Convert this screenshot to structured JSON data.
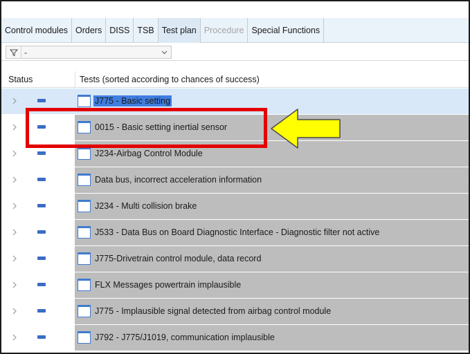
{
  "tabs": [
    {
      "label": "Control modules",
      "state": "normal"
    },
    {
      "label": "Orders",
      "state": "normal"
    },
    {
      "label": "DISS",
      "state": "normal"
    },
    {
      "label": "TSB",
      "state": "normal"
    },
    {
      "label": "Test plan",
      "state": "active"
    },
    {
      "label": "Procedure",
      "state": "disabled"
    },
    {
      "label": "Special Functions",
      "state": "normal"
    }
  ],
  "filter": {
    "value": "-",
    "icon": "funnel-icon"
  },
  "columns": {
    "status": "Status",
    "tests": "Tests (sorted according to chances of success)"
  },
  "tests": [
    {
      "label": "J775 - Basic setting",
      "selected": true
    },
    {
      "label": "0015 - Basic setting inertial sensor",
      "selected": false
    },
    {
      "label": "J234-Airbag Control Module",
      "selected": false
    },
    {
      "label": "Data bus, incorrect acceleration information",
      "selected": false
    },
    {
      "label": "J234 - Multi collision brake",
      "selected": false
    },
    {
      "label": "J533 - Data Bus on Board Diagnostic Interface  - Diagnostic filter not active",
      "selected": false
    },
    {
      "label": "J775-Drivetrain control module, data record",
      "selected": false
    },
    {
      "label": "FLX Messages powertrain implausible",
      "selected": false
    },
    {
      "label": "J775 - Implausible signal detected from airbag control module",
      "selected": false
    },
    {
      "label": "J792 - J775/J1019, communication implausible",
      "selected": false
    }
  ],
  "colors": {
    "highlight_box": "#e30000",
    "arrow_fill": "#ffff00",
    "selection": "#3f7de0",
    "status_dash": "#3b6cc7"
  }
}
